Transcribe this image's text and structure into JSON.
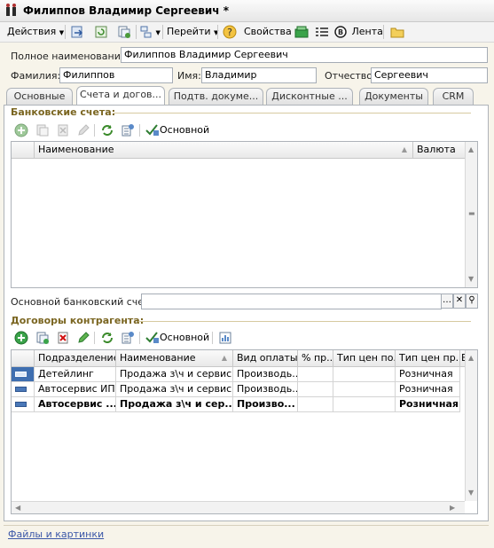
{
  "window": {
    "title": "Филиппов Владимир Сергеевич *"
  },
  "toolbar": {
    "actions_label": "Действия",
    "go_label": "Перейти",
    "properties_label": "Свойства",
    "feed_label": "Лента"
  },
  "form": {
    "full_name_label": "Полное наименование:",
    "full_name_value": "Филиппов Владимир Сергеевич",
    "last_name_label": "Фамилия:",
    "last_name_value": "Филиппов",
    "first_name_label": "Имя:",
    "first_name_value": "Владимир",
    "middle_name_label": "Отчество:",
    "middle_name_value": "Сергеевич"
  },
  "tabs": [
    {
      "label": "Основные"
    },
    {
      "label": "Счета и догов..."
    },
    {
      "label": "Подтв. докуме..."
    },
    {
      "label": "Дисконтные ..."
    },
    {
      "label": "Документы"
    },
    {
      "label": "CRM"
    }
  ],
  "bank": {
    "section_title": "Банковские счета:",
    "main_button_label": "Основной",
    "columns": [
      "Наименование",
      "Валюта"
    ],
    "main_account_label": "Основной банковский счет:",
    "main_account_value": ""
  },
  "contracts": {
    "section_title": "Договоры контрагента:",
    "main_button_label": "Основной",
    "columns": [
      "Подразделение",
      "Наименование",
      "Вид оплаты",
      "% пр...",
      "Тип цен по...",
      "Тип цен пр...",
      "В"
    ],
    "rows": [
      {
        "bold": false,
        "cells": [
          "Детейлинг",
          "Продажа з\\ч и сервис ...",
          "Производь...",
          "",
          "",
          "Розничная"
        ]
      },
      {
        "bold": false,
        "cells": [
          "Автосервис ИП",
          "Продажа з\\ч и сервис ...",
          "Производь...",
          "",
          "",
          "Розничная"
        ]
      },
      {
        "bold": true,
        "cells": [
          "Автосервис ...",
          "Продажа з\\ч и сер...",
          "Произво...",
          "",
          "",
          "Розничная"
        ]
      }
    ]
  },
  "footer": {
    "link_label": "Файлы и картинки"
  },
  "colors": {
    "section_title": "#7a6520",
    "link": "#3b57a8",
    "background": "#f7f4ea"
  }
}
